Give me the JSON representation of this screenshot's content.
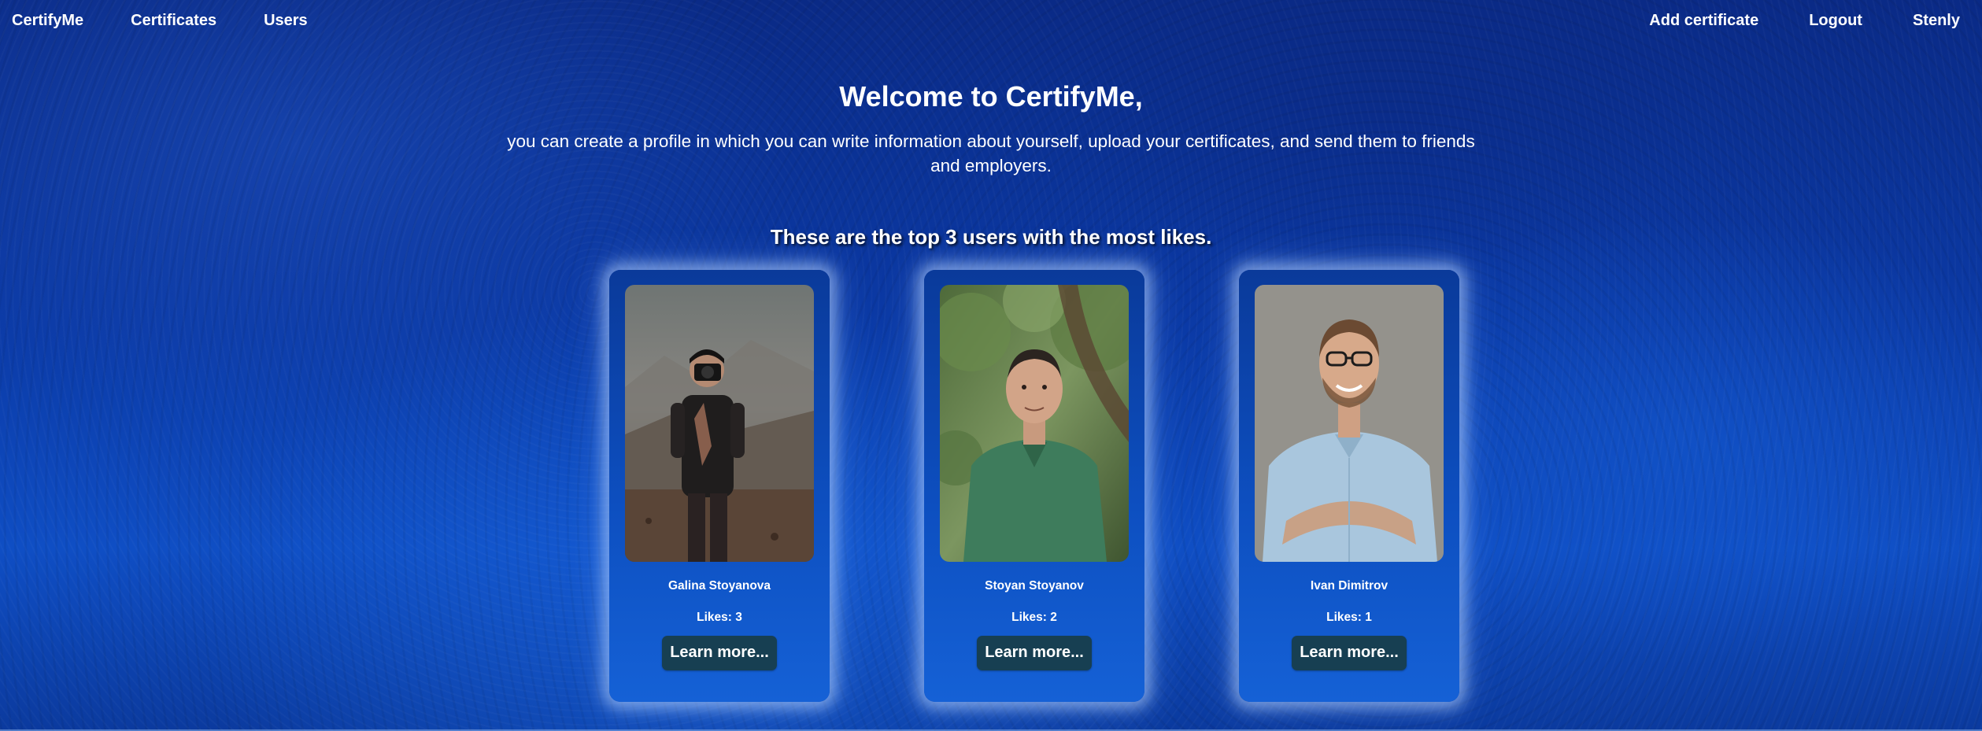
{
  "nav": {
    "brand": "CertifyMe",
    "certificates": "Certificates",
    "users": "Users",
    "add_certificate": "Add certificate",
    "logout": "Logout",
    "username": "Stenly"
  },
  "hero": {
    "title": "Welcome to CertifyMe,",
    "description": "you can create a profile in which you can write information about yourself, upload your certificates, and send them to friends and employers."
  },
  "top_users": {
    "heading": "These are the top 3 users with the most likes.",
    "users": [
      {
        "name": "Galina Stoyanova",
        "likes": "Likes: 3",
        "button": "Learn more..."
      },
      {
        "name": "Stoyan Stoyanov",
        "likes": "Likes: 2",
        "button": "Learn more..."
      },
      {
        "name": "Ivan Dimitrov",
        "likes": "Likes: 1",
        "button": "Learn more..."
      }
    ]
  },
  "colors": {
    "background_primary": "#0b3aa6",
    "card_glow": "#bed7ff",
    "button_background": "#173f52",
    "text": "#ffffff"
  }
}
